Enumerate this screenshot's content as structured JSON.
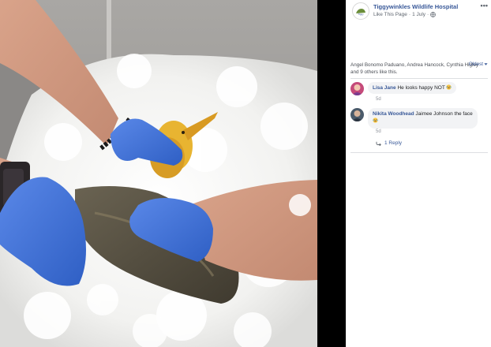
{
  "post": {
    "page_name": "Tiggywinkles Wildlife Hospital",
    "like_link": "Like This Page",
    "separator": "·",
    "date": "1 July",
    "separator2": "·",
    "more_icon": "more-horizontal-icon"
  },
  "likes": {
    "text": "Angel Bonomo Paduano, Andrea Hancock, Cynthia Higley and 9 others like this.",
    "sort_label": "Oldest"
  },
  "comments": [
    {
      "author": "Lisa Jane",
      "text": "He looks happy NOT",
      "emoji": "laughing-tears-emoji",
      "time": "5d"
    },
    {
      "author": "Nikita Woodhead",
      "text": "Jaimee Johnson the face",
      "emoji": "laughing-tears-emoji",
      "time": "5d",
      "reply_label": "1 Reply"
    }
  ],
  "colors": {
    "link": "#385898",
    "bubble": "#f2f3f5",
    "glove": "#3d6fd6",
    "beak": "#e0a52a"
  }
}
